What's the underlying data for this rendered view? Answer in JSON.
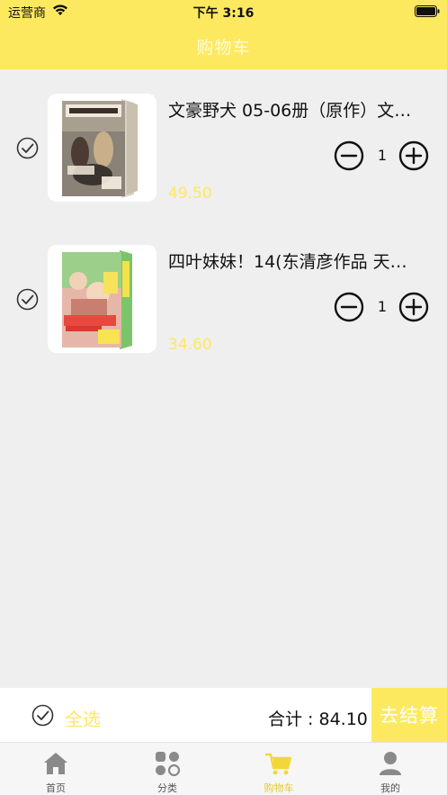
{
  "status_bar": {
    "carrier": "运营商",
    "time": "下午 3:16"
  },
  "nav": {
    "title": "购物车"
  },
  "cart": {
    "items": [
      {
        "title": "文豪野犬 05-06册（原作）文…",
        "quantity": "1",
        "price": "49.50",
        "checked": true
      },
      {
        "title": "四叶妹妹！14(东清彦作品 天…",
        "quantity": "1",
        "price": "34.60",
        "checked": true
      }
    ]
  },
  "checkout": {
    "select_all_label": "全选",
    "total_label": "合计 : 84.10",
    "checkout_label": "去结算"
  },
  "tabbar": {
    "tabs": [
      {
        "label": "首页",
        "icon": "home-icon"
      },
      {
        "label": "分类",
        "icon": "category-grid-icon"
      },
      {
        "label": "购物车",
        "icon": "cart-icon",
        "active": true
      },
      {
        "label": "我的",
        "icon": "profile-icon"
      }
    ]
  },
  "colors": {
    "accent": "#fde95f",
    "background": "#efefef",
    "text": "#111111"
  }
}
